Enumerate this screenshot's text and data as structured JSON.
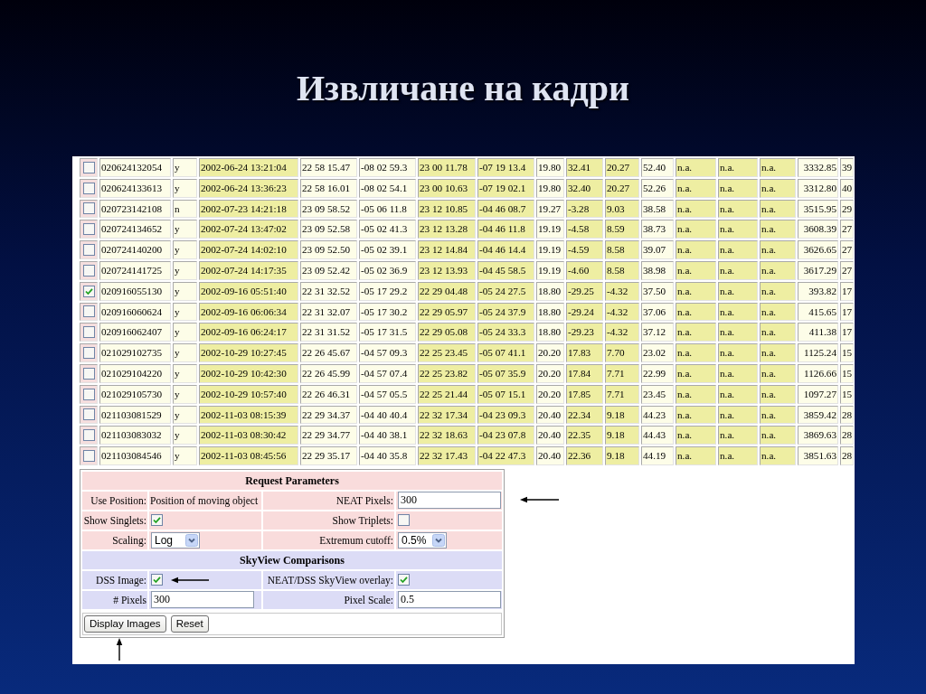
{
  "slide": {
    "title": "Извличане на кадри"
  },
  "results_table": {
    "rows": [
      {
        "checked": false,
        "cells": [
          "020624132054",
          "y",
          "2002-06-24 13:21:04",
          "22 58 15.47",
          "-08 02 59.3",
          "23 00 11.78",
          "-07 19 13.4",
          "19.80",
          "32.41",
          "20.27",
          "52.40",
          "n.a.",
          "n.a.",
          "n.a.",
          "3332.85",
          "39"
        ]
      },
      {
        "checked": false,
        "cells": [
          "020624133613",
          "y",
          "2002-06-24 13:36:23",
          "22 58 16.01",
          "-08 02 54.1",
          "23 00 10.63",
          "-07 19 02.1",
          "19.80",
          "32.40",
          "20.27",
          "52.26",
          "n.a.",
          "n.a.",
          "n.a.",
          "3312.80",
          "40"
        ]
      },
      {
        "checked": false,
        "cells": [
          "020723142108",
          "n",
          "2002-07-23 14:21:18",
          "23 09 58.52",
          "-05 06 11.8",
          "23 12 10.85",
          "-04 46 08.7",
          "19.27",
          "-3.28",
          "9.03",
          "38.58",
          "n.a.",
          "n.a.",
          "n.a.",
          "3515.95",
          "29"
        ]
      },
      {
        "checked": false,
        "cells": [
          "020724134652",
          "y",
          "2002-07-24 13:47:02",
          "23 09 52.58",
          "-05 02 41.3",
          "23 12 13.28",
          "-04 46 11.8",
          "19.19",
          "-4.58",
          "8.59",
          "38.73",
          "n.a.",
          "n.a.",
          "n.a.",
          "3608.39",
          "27"
        ]
      },
      {
        "checked": false,
        "cells": [
          "020724140200",
          "y",
          "2002-07-24 14:02:10",
          "23 09 52.50",
          "-05 02 39.1",
          "23 12 14.84",
          "-04 46 14.4",
          "19.19",
          "-4.59",
          "8.58",
          "39.07",
          "n.a.",
          "n.a.",
          "n.a.",
          "3626.65",
          "27"
        ]
      },
      {
        "checked": false,
        "cells": [
          "020724141725",
          "y",
          "2002-07-24 14:17:35",
          "23 09 52.42",
          "-05 02 36.9",
          "23 12 13.93",
          "-04 45 58.5",
          "19.19",
          "-4.60",
          "8.58",
          "38.98",
          "n.a.",
          "n.a.",
          "n.a.",
          "3617.29",
          "27"
        ]
      },
      {
        "checked": true,
        "cells": [
          "020916055130",
          "y",
          "2002-09-16 05:51:40",
          "22 31 32.52",
          "-05 17 29.2",
          "22 29 04.48",
          "-05 24 27.5",
          "18.80",
          "-29.25",
          "-4.32",
          "37.50",
          "n.a.",
          "n.a.",
          "n.a.",
          "393.82",
          "17"
        ]
      },
      {
        "checked": false,
        "cells": [
          "020916060624",
          "y",
          "2002-09-16 06:06:34",
          "22 31 32.07",
          "-05 17 30.2",
          "22 29 05.97",
          "-05 24 37.9",
          "18.80",
          "-29.24",
          "-4.32",
          "37.06",
          "n.a.",
          "n.a.",
          "n.a.",
          "415.65",
          "17"
        ]
      },
      {
        "checked": false,
        "cells": [
          "020916062407",
          "y",
          "2002-09-16 06:24:17",
          "22 31 31.52",
          "-05 17 31.5",
          "22 29 05.08",
          "-05 24 33.3",
          "18.80",
          "-29.23",
          "-4.32",
          "37.12",
          "n.a.",
          "n.a.",
          "n.a.",
          "411.38",
          "17"
        ]
      },
      {
        "checked": false,
        "cells": [
          "021029102735",
          "y",
          "2002-10-29 10:27:45",
          "22 26 45.67",
          "-04 57 09.3",
          "22 25 23.45",
          "-05 07 41.1",
          "20.20",
          "17.83",
          "7.70",
          "23.02",
          "n.a.",
          "n.a.",
          "n.a.",
          "1125.24",
          "15"
        ]
      },
      {
        "checked": false,
        "cells": [
          "021029104220",
          "y",
          "2002-10-29 10:42:30",
          "22 26 45.99",
          "-04 57 07.4",
          "22 25 23.82",
          "-05 07 35.9",
          "20.20",
          "17.84",
          "7.71",
          "22.99",
          "n.a.",
          "n.a.",
          "n.a.",
          "1126.66",
          "15"
        ]
      },
      {
        "checked": false,
        "cells": [
          "021029105730",
          "y",
          "2002-10-29 10:57:40",
          "22 26 46.31",
          "-04 57 05.5",
          "22 25 21.44",
          "-05 07 15.1",
          "20.20",
          "17.85",
          "7.71",
          "23.45",
          "n.a.",
          "n.a.",
          "n.a.",
          "1097.27",
          "15"
        ]
      },
      {
        "checked": false,
        "cells": [
          "021103081529",
          "y",
          "2002-11-03 08:15:39",
          "22 29 34.37",
          "-04 40 40.4",
          "22 32 17.34",
          "-04 23 09.3",
          "20.40",
          "22.34",
          "9.18",
          "44.23",
          "n.a.",
          "n.a.",
          "n.a.",
          "3859.42",
          "28"
        ]
      },
      {
        "checked": false,
        "cells": [
          "021103083032",
          "y",
          "2002-11-03 08:30:42",
          "22 29 34.77",
          "-04 40 38.1",
          "22 32 18.63",
          "-04 23 07.8",
          "20.40",
          "22.35",
          "9.18",
          "44.43",
          "n.a.",
          "n.a.",
          "n.a.",
          "3869.63",
          "28"
        ]
      },
      {
        "checked": false,
        "cells": [
          "021103084546",
          "y",
          "2002-11-03 08:45:56",
          "22 29 35.17",
          "-04 40 35.8",
          "22 32 17.43",
          "-04 22 47.3",
          "20.40",
          "22.36",
          "9.18",
          "44.19",
          "n.a.",
          "n.a.",
          "n.a.",
          "3851.63",
          "28"
        ]
      }
    ]
  },
  "request_form": {
    "sections": [
      {
        "title": "Request Parameters",
        "color": "#f9dcdc",
        "rows": [
          {
            "fields": [
              {
                "kind": "text",
                "label": "Use Position:",
                "value": "Position of moving object"
              },
              {
                "kind": "input",
                "label": "NEAT Pixels:",
                "value": "300"
              }
            ]
          },
          {
            "fields": [
              {
                "kind": "checkbox",
                "label": "Show Singlets:",
                "checked": true
              },
              {
                "kind": "checkbox",
                "label": "Show Triplets:",
                "checked": false
              }
            ]
          },
          {
            "fields": [
              {
                "kind": "select",
                "label": "Scaling:",
                "value": "Log"
              },
              {
                "kind": "select",
                "label": "Extremum cutoff:",
                "value": "0.5%"
              }
            ]
          }
        ]
      },
      {
        "title": "SkyView Comparisons",
        "color": "#dcdcf6",
        "rows": [
          {
            "fields": [
              {
                "kind": "checkbox",
                "label": "DSS Image:",
                "checked": true
              },
              {
                "kind": "checkbox",
                "label": "NEAT/DSS SkyView overlay:",
                "checked": true
              }
            ]
          },
          {
            "fields": [
              {
                "kind": "input",
                "label": "# Pixels",
                "value": "300"
              },
              {
                "kind": "input",
                "label": "Pixel Scale:",
                "value": "0.5"
              }
            ]
          }
        ]
      }
    ],
    "buttons": [
      {
        "label": "Display Images"
      },
      {
        "label": "Reset"
      }
    ]
  }
}
